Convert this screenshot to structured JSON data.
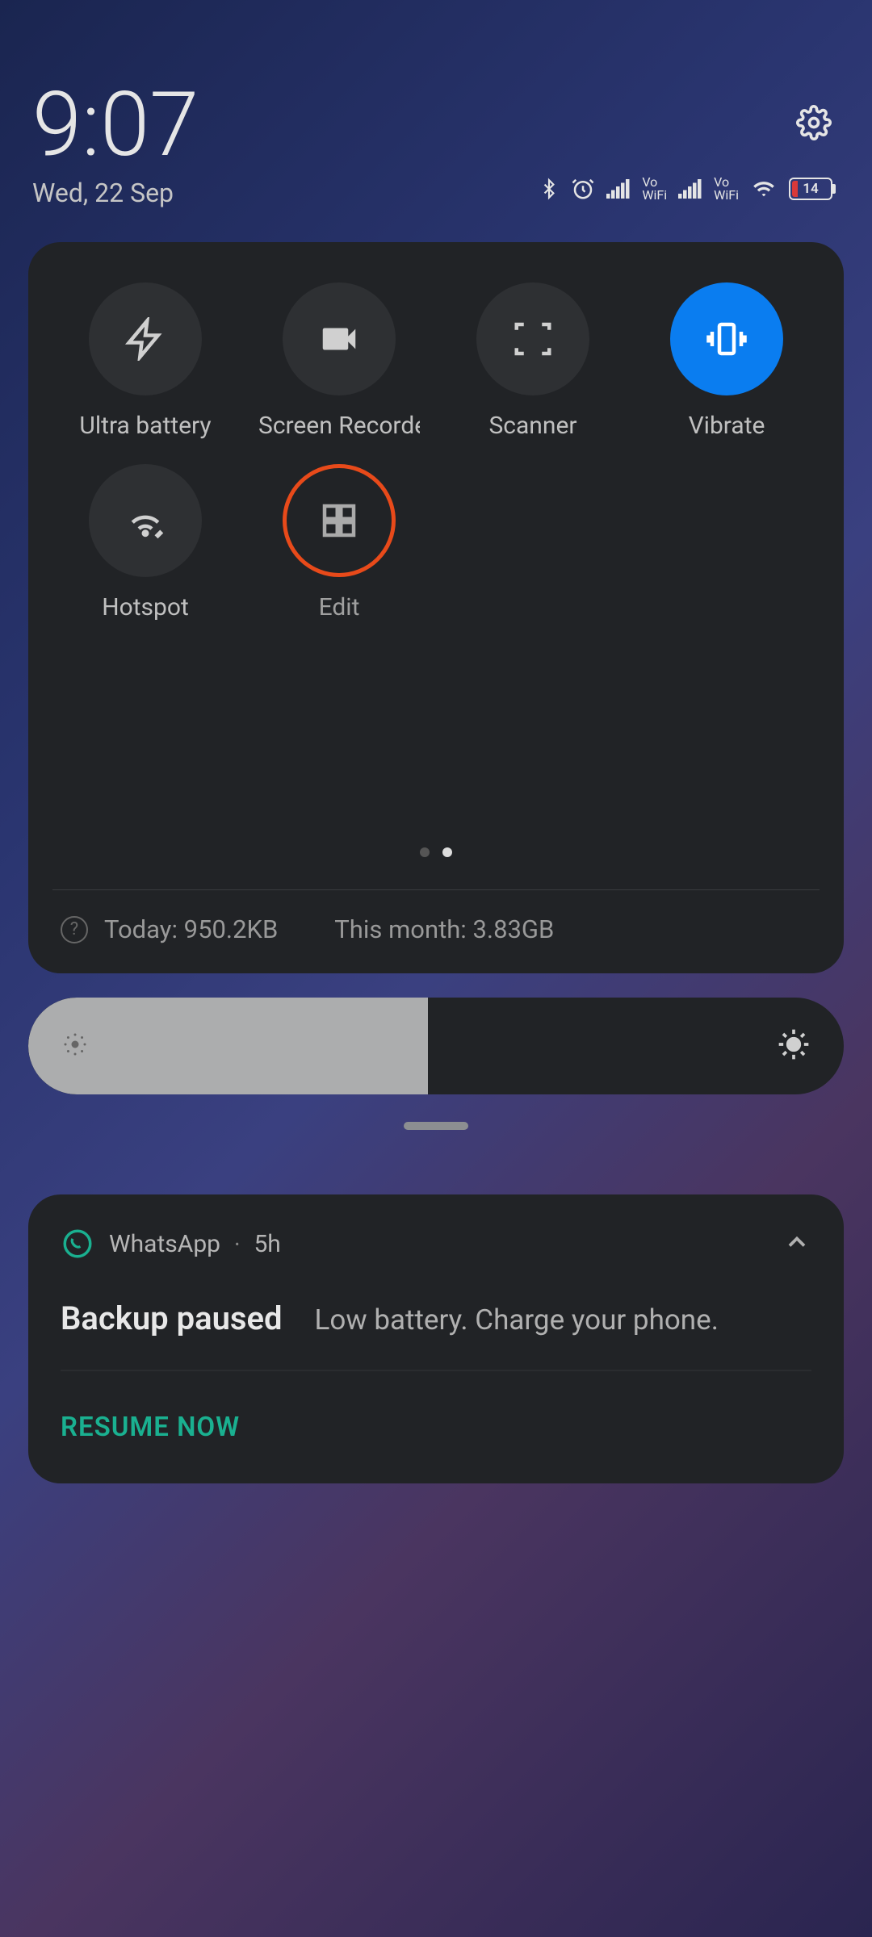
{
  "header": {
    "time": "9:07",
    "date": "Wed, 22 Sep"
  },
  "status": {
    "vowifi_top": "Vo",
    "vowifi_bottom": "WiFi",
    "battery_percent": "14"
  },
  "tiles": [
    {
      "label": "Ultra battery",
      "icon": "bolt",
      "state": "off"
    },
    {
      "label": "Screen Recorder",
      "icon": "video",
      "state": "off"
    },
    {
      "label": "Scanner",
      "icon": "scan",
      "state": "off"
    },
    {
      "label": "Vibrate",
      "icon": "vibrate",
      "state": "on"
    },
    {
      "label": "Hotspot",
      "icon": "hotspot",
      "state": "off"
    },
    {
      "label": "Edit",
      "icon": "grid",
      "state": "outlined"
    }
  ],
  "data_usage": {
    "today_label": "Today: 950.2KB",
    "month_label": "This month: 3.83GB"
  },
  "brightness": {
    "percent": 49
  },
  "notification": {
    "app": "WhatsApp",
    "time": "5h",
    "title": "Backup paused",
    "text": "Low battery. Charge your phone.",
    "action": "RESUME NOW"
  }
}
